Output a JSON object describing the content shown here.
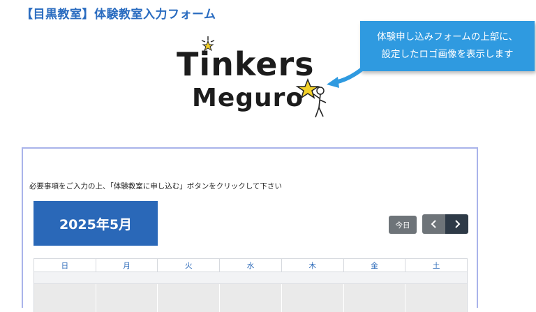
{
  "header": {
    "title": "【目黒教室】体験教室入力フォーム"
  },
  "logo": {
    "line1": "Tinkers",
    "line2": "Meguro"
  },
  "callout": {
    "line1": "体験申し込みフォームの上部に、",
    "line2": "設定したロゴ画像を表示します",
    "color": "#2f9ae0"
  },
  "form": {
    "instruction": "必要事項をご入力の上、「体験教室に申し込む」ボタンをクリックして下さい"
  },
  "calendar": {
    "month_label": "2025年5月",
    "today_label": "今日",
    "prev_icon": "chevron-left-icon",
    "next_icon": "chevron-right-icon",
    "weekdays": [
      "日",
      "月",
      "火",
      "水",
      "木",
      "金",
      "土"
    ],
    "accent_color": "#2a68b8"
  }
}
